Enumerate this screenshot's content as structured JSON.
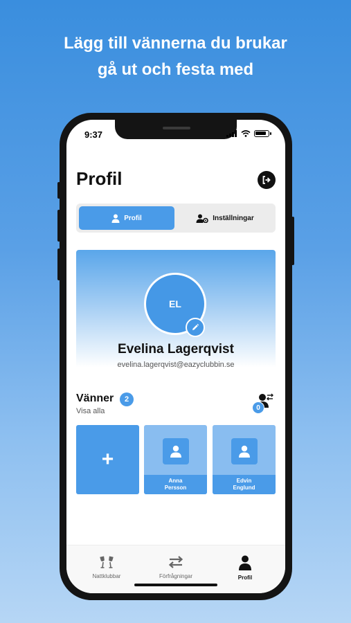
{
  "headline": {
    "line1": "Lägg till vännerna du brukar",
    "line2": "gå ut och festa med"
  },
  "status_bar": {
    "time": "9:37"
  },
  "header": {
    "title": "Profil",
    "logout_icon": "logout-icon"
  },
  "segmented": {
    "tabs": [
      {
        "label": "Profil",
        "icon": "user-icon",
        "active": true
      },
      {
        "label": "Inställningar",
        "icon": "user-settings-icon",
        "active": false
      }
    ]
  },
  "profile": {
    "initials": "EL",
    "name": "Evelina Lagerqvist",
    "email": "evelina.lagerqvist@eazyclubbin.se"
  },
  "friends": {
    "title": "Vänner",
    "count": "2",
    "see_all": "Visa alla",
    "requests_count": "0",
    "add_symbol": "+",
    "items": [
      {
        "first": "Anna",
        "last": "Persson"
      },
      {
        "first": "Edvin",
        "last": "Englund"
      }
    ]
  },
  "tabbar": {
    "items": [
      {
        "label": "Nattklubbar",
        "icon": "cheers-icon",
        "active": false
      },
      {
        "label": "Förfrågningar",
        "icon": "swap-arrows-icon",
        "active": false
      },
      {
        "label": "Profil",
        "icon": "user-icon",
        "active": true
      }
    ]
  },
  "colors": {
    "accent": "#4a9be8",
    "tile_light": "#89bdf0",
    "text_dark": "#111111",
    "tab_inactive": "#666666"
  }
}
